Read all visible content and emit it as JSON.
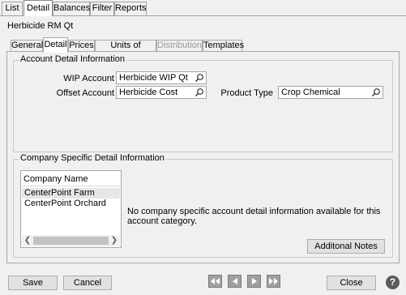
{
  "top_tabs": [
    {
      "label": "List"
    },
    {
      "label": "Detail"
    },
    {
      "label": "Balances"
    },
    {
      "label": "Filter"
    },
    {
      "label": "Reports"
    }
  ],
  "page_title": "Herbicide RM Qt",
  "sub_tabs": [
    {
      "label": "General"
    },
    {
      "label": "Detail"
    },
    {
      "label": "Prices"
    },
    {
      "label": "Units of Measure"
    },
    {
      "label": "Distributions"
    },
    {
      "label": "Templates"
    }
  ],
  "account_detail": {
    "title": "Account Detail Information",
    "wip_label": "WIP Account",
    "wip_value": "Herbicide WIP Qt",
    "offset_label": "Offset Account",
    "offset_value": "Herbicide Cost",
    "product_type_label": "Product Type",
    "product_type_value": "Crop Chemical"
  },
  "company_detail": {
    "title": "Company Specific Detail Information",
    "column_header": "Company Name",
    "companies": [
      {
        "name": "CenterPoint Farm",
        "selected": true
      },
      {
        "name": "CenterPoint Orchard",
        "selected": false
      }
    ],
    "message": "No company specific account detail information available for this account category.",
    "additional_notes_label": "Additonal Notes"
  },
  "footer": {
    "save_label": "Save",
    "cancel_label": "Cancel",
    "close_label": "Close",
    "help_label": "?"
  },
  "colors": {
    "background": "#f0f0f0",
    "nav_button": "#a0a0a0",
    "help_button": "#5b5b5b"
  },
  "icons": [
    "search-icon",
    "scroll-left-icon",
    "scroll-right-icon",
    "first-record-icon",
    "previous-record-icon",
    "next-record-icon",
    "last-record-icon",
    "help-icon"
  ]
}
